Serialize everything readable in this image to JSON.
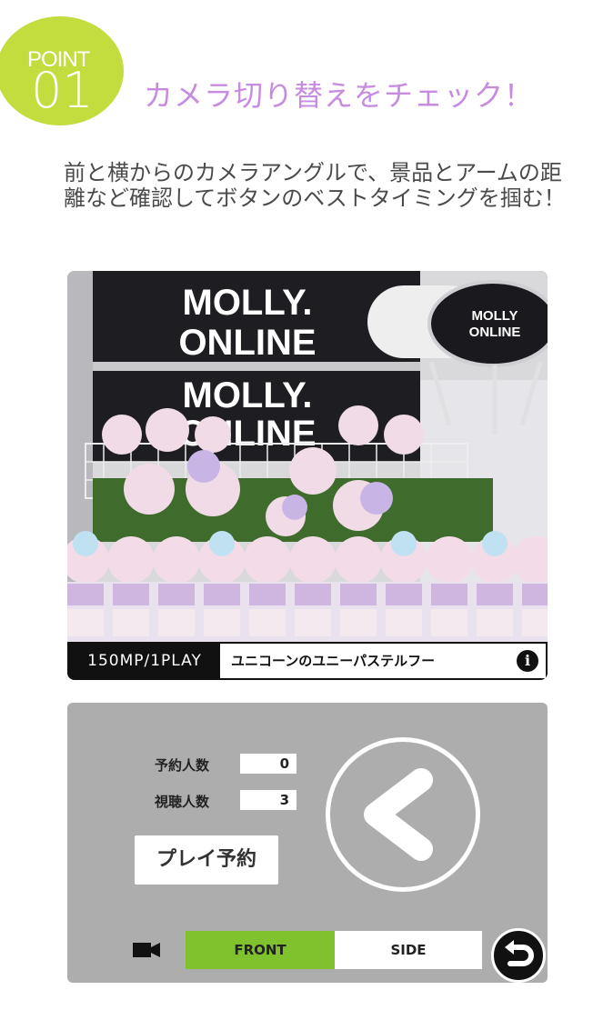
{
  "badge": {
    "point": "POINT",
    "number": "01"
  },
  "heading": "カメラ切り替えをチェック！",
  "description": "前と横からのカメラアングルで、景品とアームの距離など確認してボタンのベストタイミングを掴む！",
  "video": {
    "sign_top": [
      "MOLLY.",
      "ONLINE"
    ],
    "sign_bottom": [
      "MOLLY.",
      "ONLINE"
    ],
    "claw_logo": [
      "MOLLY",
      "ONLINE"
    ],
    "price": "150MP/1PLAY",
    "prize_name": "ユニコーンのユニーパステルフー",
    "info_icon": "i"
  },
  "panel": {
    "reservations_label": "予約人数",
    "reservations_value": "0",
    "viewers_label": "視聴人数",
    "viewers_value": "3",
    "reserve_button": "プレイ予約",
    "tabs": [
      {
        "label": "FRONT",
        "active": true
      },
      {
        "label": "SIDE",
        "active": false
      }
    ],
    "icons": {
      "camera": "video-camera-icon",
      "arrow": "chevron-left-icon",
      "return": "return-arrow-icon"
    }
  },
  "colors": {
    "badge": "#c3dc3e",
    "heading": "#c78be0",
    "active_tab": "#7fc22e",
    "panel": "#adadad"
  }
}
